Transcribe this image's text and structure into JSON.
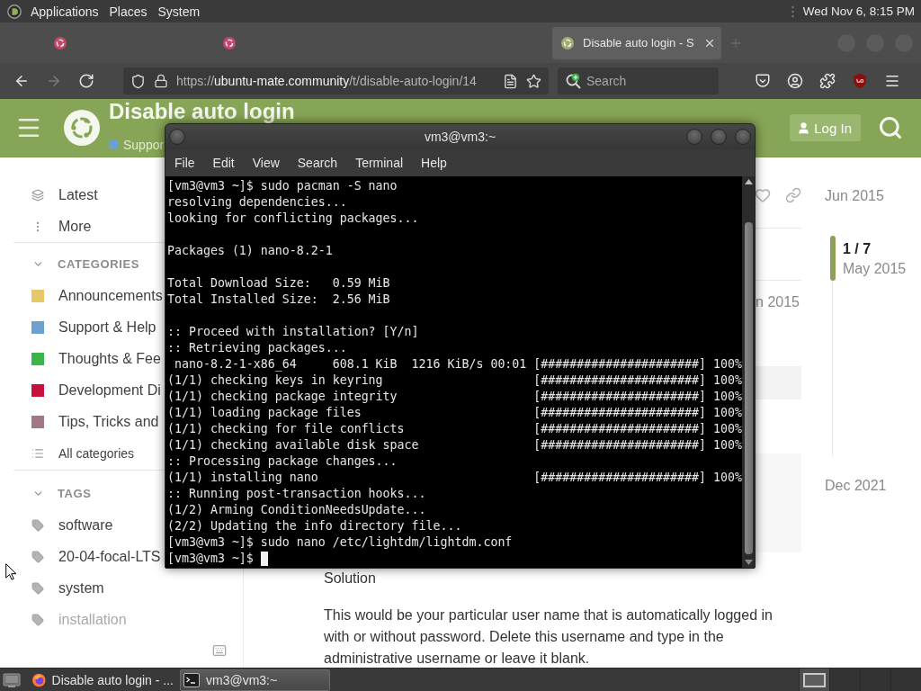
{
  "top_panel": {
    "menus": [
      "Applications",
      "Places",
      "System"
    ],
    "clock": "Wed Nov 6, 8:15 PM"
  },
  "browser": {
    "tabs": [
      {
        "color": "#c5476a",
        "selected": false
      },
      {
        "color": "#c5476a",
        "selected": false
      },
      {
        "selected": false
      },
      {
        "title": "Disable auto login - S",
        "color": "#a3ad73",
        "selected": true
      }
    ],
    "back": {
      "disabled": false
    },
    "forward": {
      "disabled": true
    },
    "url": "https://**ubuntu-mate.community**/t/disable-auto-login/14",
    "search_placeholder": "Search"
  },
  "site_header": {
    "title": "Disable auto login",
    "category": {
      "name": "Suppor",
      "color": "#6d9fd0"
    },
    "login": "Log In"
  },
  "sidebar": {
    "links": [
      {
        "kind": "latest",
        "label": "Latest"
      },
      {
        "kind": "more",
        "label": "More"
      }
    ],
    "sections": [
      {
        "kind": "categories",
        "heading": "CATEGORIES",
        "expanded": true,
        "items": [
          {
            "label": "Announcements",
            "color": "#e6c86a"
          },
          {
            "label": "Support & Help",
            "color": "#6d9fd0"
          },
          {
            "label": "Thoughts & Fee",
            "color": "#3ab54a"
          },
          {
            "label": "Development Di",
            "color": "#c8103e"
          },
          {
            "label": "Tips, Tricks and",
            "color": "#a07888"
          }
        ],
        "footer": "All categories"
      },
      {
        "kind": "tags",
        "heading": "TAGS",
        "expanded": true,
        "items": [
          {
            "label": "software"
          },
          {
            "label": "20-04-focal-LTS"
          },
          {
            "label": "system"
          },
          {
            "label": "installation"
          }
        ]
      }
    ]
  },
  "topic": {
    "post_date": "n 2015",
    "solution_label": "Solution",
    "paragraph": "This would be your particular user name that is automatically logged in with or without password. Delete this username and type in the administrative username or leave it blank."
  },
  "timeline": {
    "start": "Jun 2015",
    "position": "1 / 7",
    "position_date": "May 2015",
    "end": "Dec 2021"
  },
  "terminal": {
    "title": "vm3@vm3:~",
    "menu": [
      "File",
      "Edit",
      "View",
      "Search",
      "Terminal",
      "Help"
    ],
    "cursor": true,
    "blocks": [
      [
        "[vm3@vm3 ~]$ sudo pacman -S nano",
        "resolving dependencies...",
        "looking for conflicting packages..."
      ],
      [
        "Packages (1) nano-8.2-1"
      ],
      [
        "Total Download Size:   0.59 MiB",
        "Total Installed Size:  2.56 MiB"
      ],
      [
        ":: Proceed with installation? [Y/n]",
        ":: Retrieving packages...",
        " nano-8.2-1-x86_64     608.1 KiB  1216 KiB/s 00:01 [######################] 100%",
        "(1/1) checking keys in keyring                     [######################] 100%",
        "(1/1) checking package integrity                   [######################] 100%",
        "(1/1) loading package files                        [######################] 100%",
        "(1/1) checking for file conflicts                  [######################] 100%",
        "(1/1) checking available disk space                [######################] 100%",
        ":: Processing package changes...",
        "(1/1) installing nano                              [######################] 100%",
        ":: Running post-transaction hooks...",
        "(1/2) Arming ConditionNeedsUpdate...",
        "(2/2) Updating the info directory file...",
        "[vm3@vm3 ~]$ sudo nano /etc/lightdm/lightdm.conf",
        "[vm3@vm3 ~]$"
      ]
    ]
  },
  "taskbar": {
    "tasks": [
      {
        "kind": "browser",
        "label": "Disable auto login - ...",
        "selected": false
      },
      {
        "kind": "terminal",
        "label": "vm3@vm3:~",
        "selected": true
      }
    ],
    "workspaces": [
      {
        "selected": true
      },
      {
        "selected": false
      },
      {
        "selected": false
      },
      {
        "selected": false
      }
    ]
  }
}
